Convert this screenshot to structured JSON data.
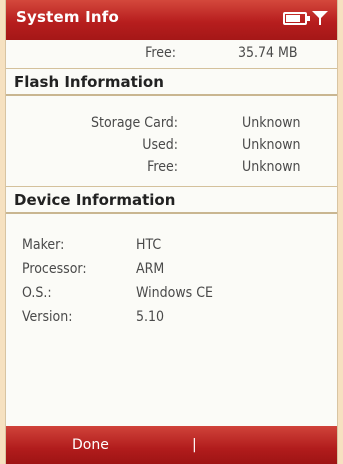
{
  "window": {
    "title": "System Info"
  },
  "status": {
    "battery_icon": "battery-icon",
    "signal_icon": "signal-icon"
  },
  "memory_partial": {
    "label": "Free:",
    "value": "35.74 MB"
  },
  "flash": {
    "heading": "Flash Information",
    "rows": [
      {
        "label": "Storage Card:",
        "value": "Unknown"
      },
      {
        "label": "Used:",
        "value": "Unknown"
      },
      {
        "label": "Free:",
        "value": "Unknown"
      }
    ]
  },
  "device": {
    "heading": "Device Information",
    "rows": [
      {
        "label": "Maker:",
        "value": "HTC"
      },
      {
        "label": "Processor:",
        "value": "ARM"
      },
      {
        "label": "O.S.:",
        "value": "Windows CE"
      },
      {
        "label": "Version:",
        "value": "5.10"
      }
    ]
  },
  "softkeys": {
    "left": "Done",
    "separator": "|"
  },
  "colors": {
    "titlebar": "#b71e1e",
    "background": "#fbfbf7",
    "frame": "#f6e1c0"
  }
}
